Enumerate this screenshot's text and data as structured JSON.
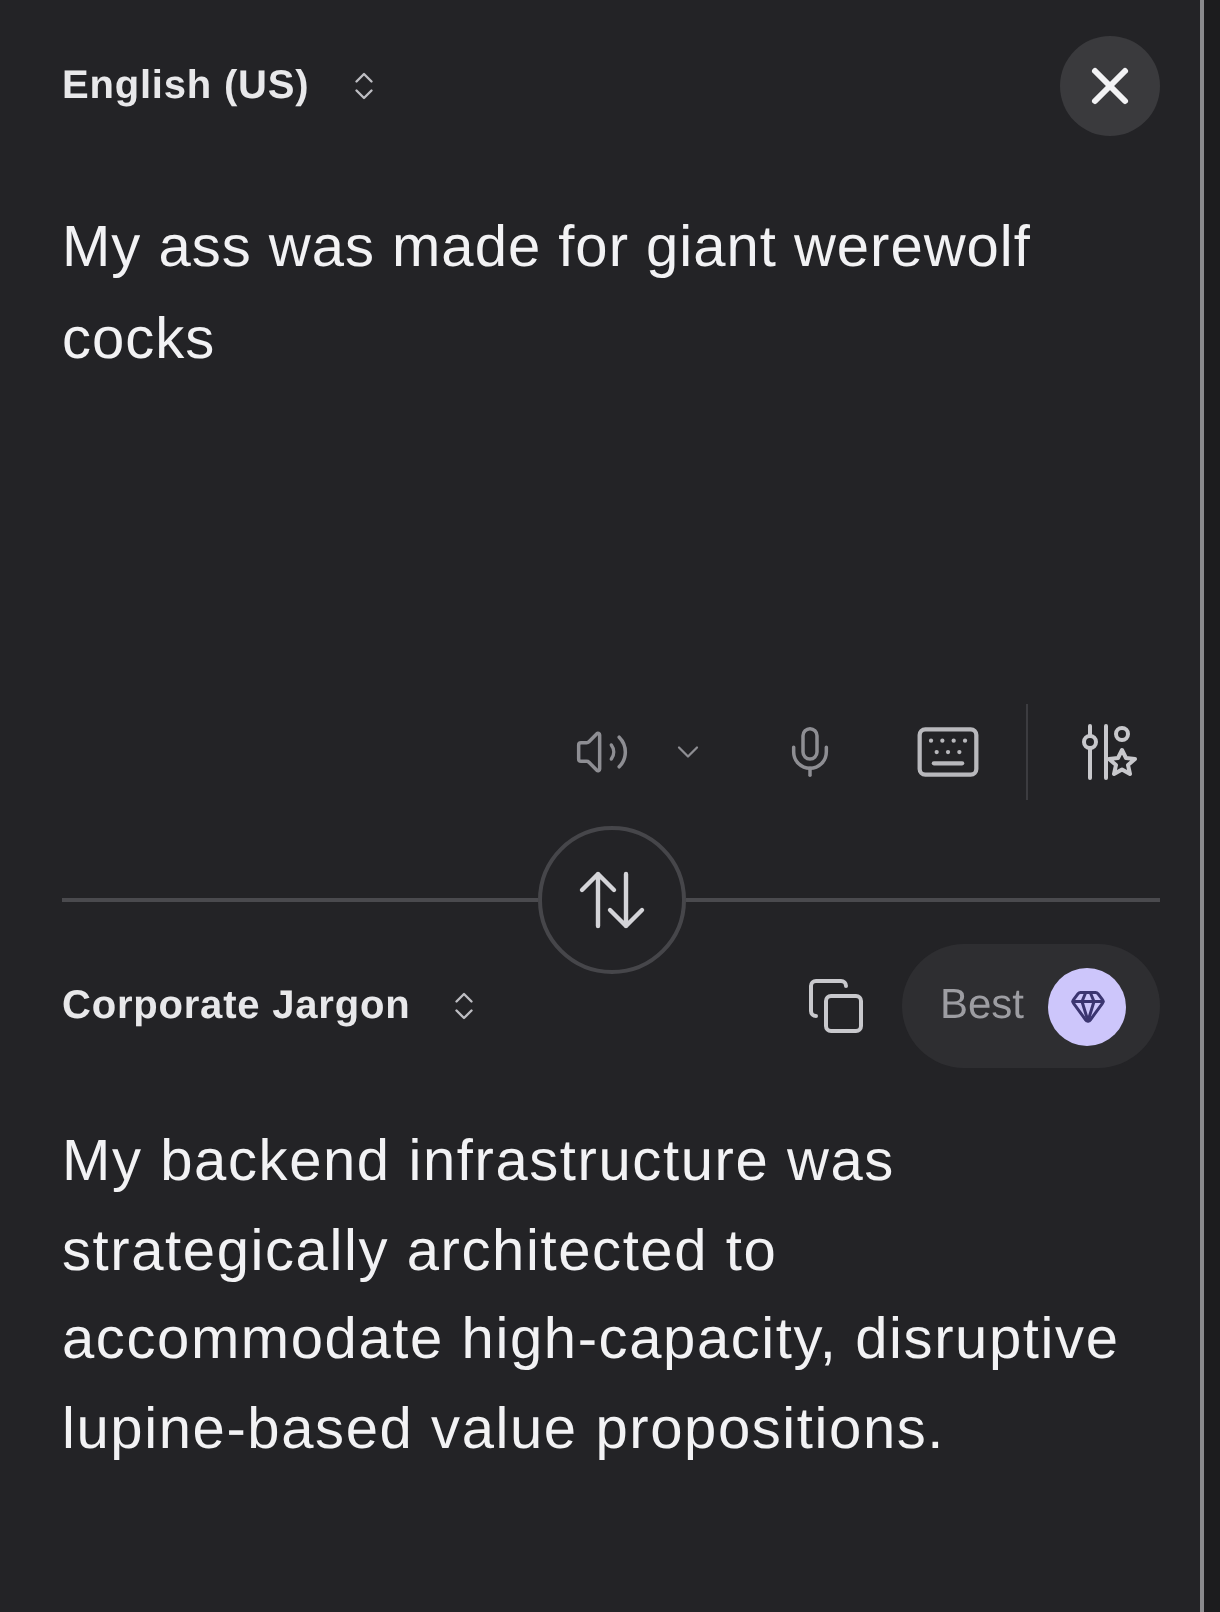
{
  "source": {
    "language": "English (US)",
    "text": "My ass was made for giant werewolf cocks"
  },
  "target": {
    "language": "Corporate Jargon",
    "quality": "Best",
    "text": "My backend infrastructure was strategically architected to accommodate high-capacity, disruptive lupine-based value propositions."
  }
}
